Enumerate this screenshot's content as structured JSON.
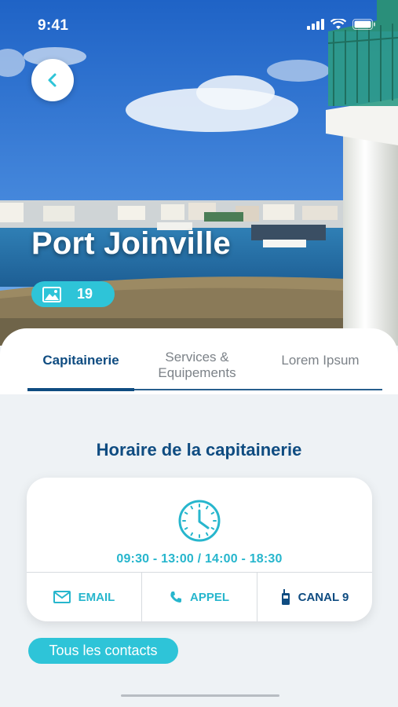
{
  "status_bar": {
    "time": "9:41"
  },
  "hero": {
    "title": "Port Joinville",
    "photo_count": "19"
  },
  "tabs": [
    {
      "label": "Capitainerie",
      "active": true
    },
    {
      "label": "Services & Equipements",
      "active": false
    },
    {
      "label": "Lorem Ipsum",
      "active": false
    }
  ],
  "section": {
    "title": "Horaire de la capitainerie",
    "hours": "09:30 - 13:00 / 14:00 - 18:30"
  },
  "actions": {
    "email": "EMAIL",
    "call": "APPEL",
    "radio": "CANAL 9"
  },
  "contacts_button": "Tous les contacts",
  "colors": {
    "accent": "#2ec4d8",
    "primary": "#0f4c81",
    "background": "#eef2f5"
  },
  "icons": [
    "chevron-left-icon",
    "image-icon",
    "clock-icon",
    "mail-icon",
    "phone-icon",
    "radio-icon",
    "signal-icon",
    "wifi-icon",
    "battery-icon"
  ]
}
